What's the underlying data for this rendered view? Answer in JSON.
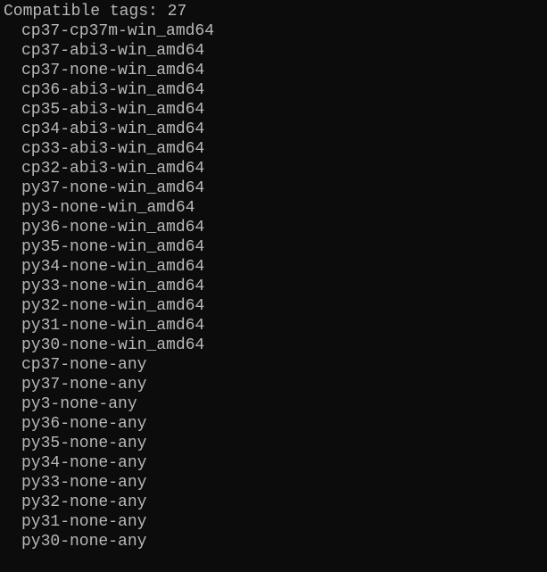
{
  "header": {
    "label": "Compatible tags:",
    "count": "27"
  },
  "tags": [
    "cp37-cp37m-win_amd64",
    "cp37-abi3-win_amd64",
    "cp37-none-win_amd64",
    "cp36-abi3-win_amd64",
    "cp35-abi3-win_amd64",
    "cp34-abi3-win_amd64",
    "cp33-abi3-win_amd64",
    "cp32-abi3-win_amd64",
    "py37-none-win_amd64",
    "py3-none-win_amd64",
    "py36-none-win_amd64",
    "py35-none-win_amd64",
    "py34-none-win_amd64",
    "py33-none-win_amd64",
    "py32-none-win_amd64",
    "py31-none-win_amd64",
    "py30-none-win_amd64",
    "cp37-none-any",
    "py37-none-any",
    "py3-none-any",
    "py36-none-any",
    "py35-none-any",
    "py34-none-any",
    "py33-none-any",
    "py32-none-any",
    "py31-none-any",
    "py30-none-any"
  ]
}
